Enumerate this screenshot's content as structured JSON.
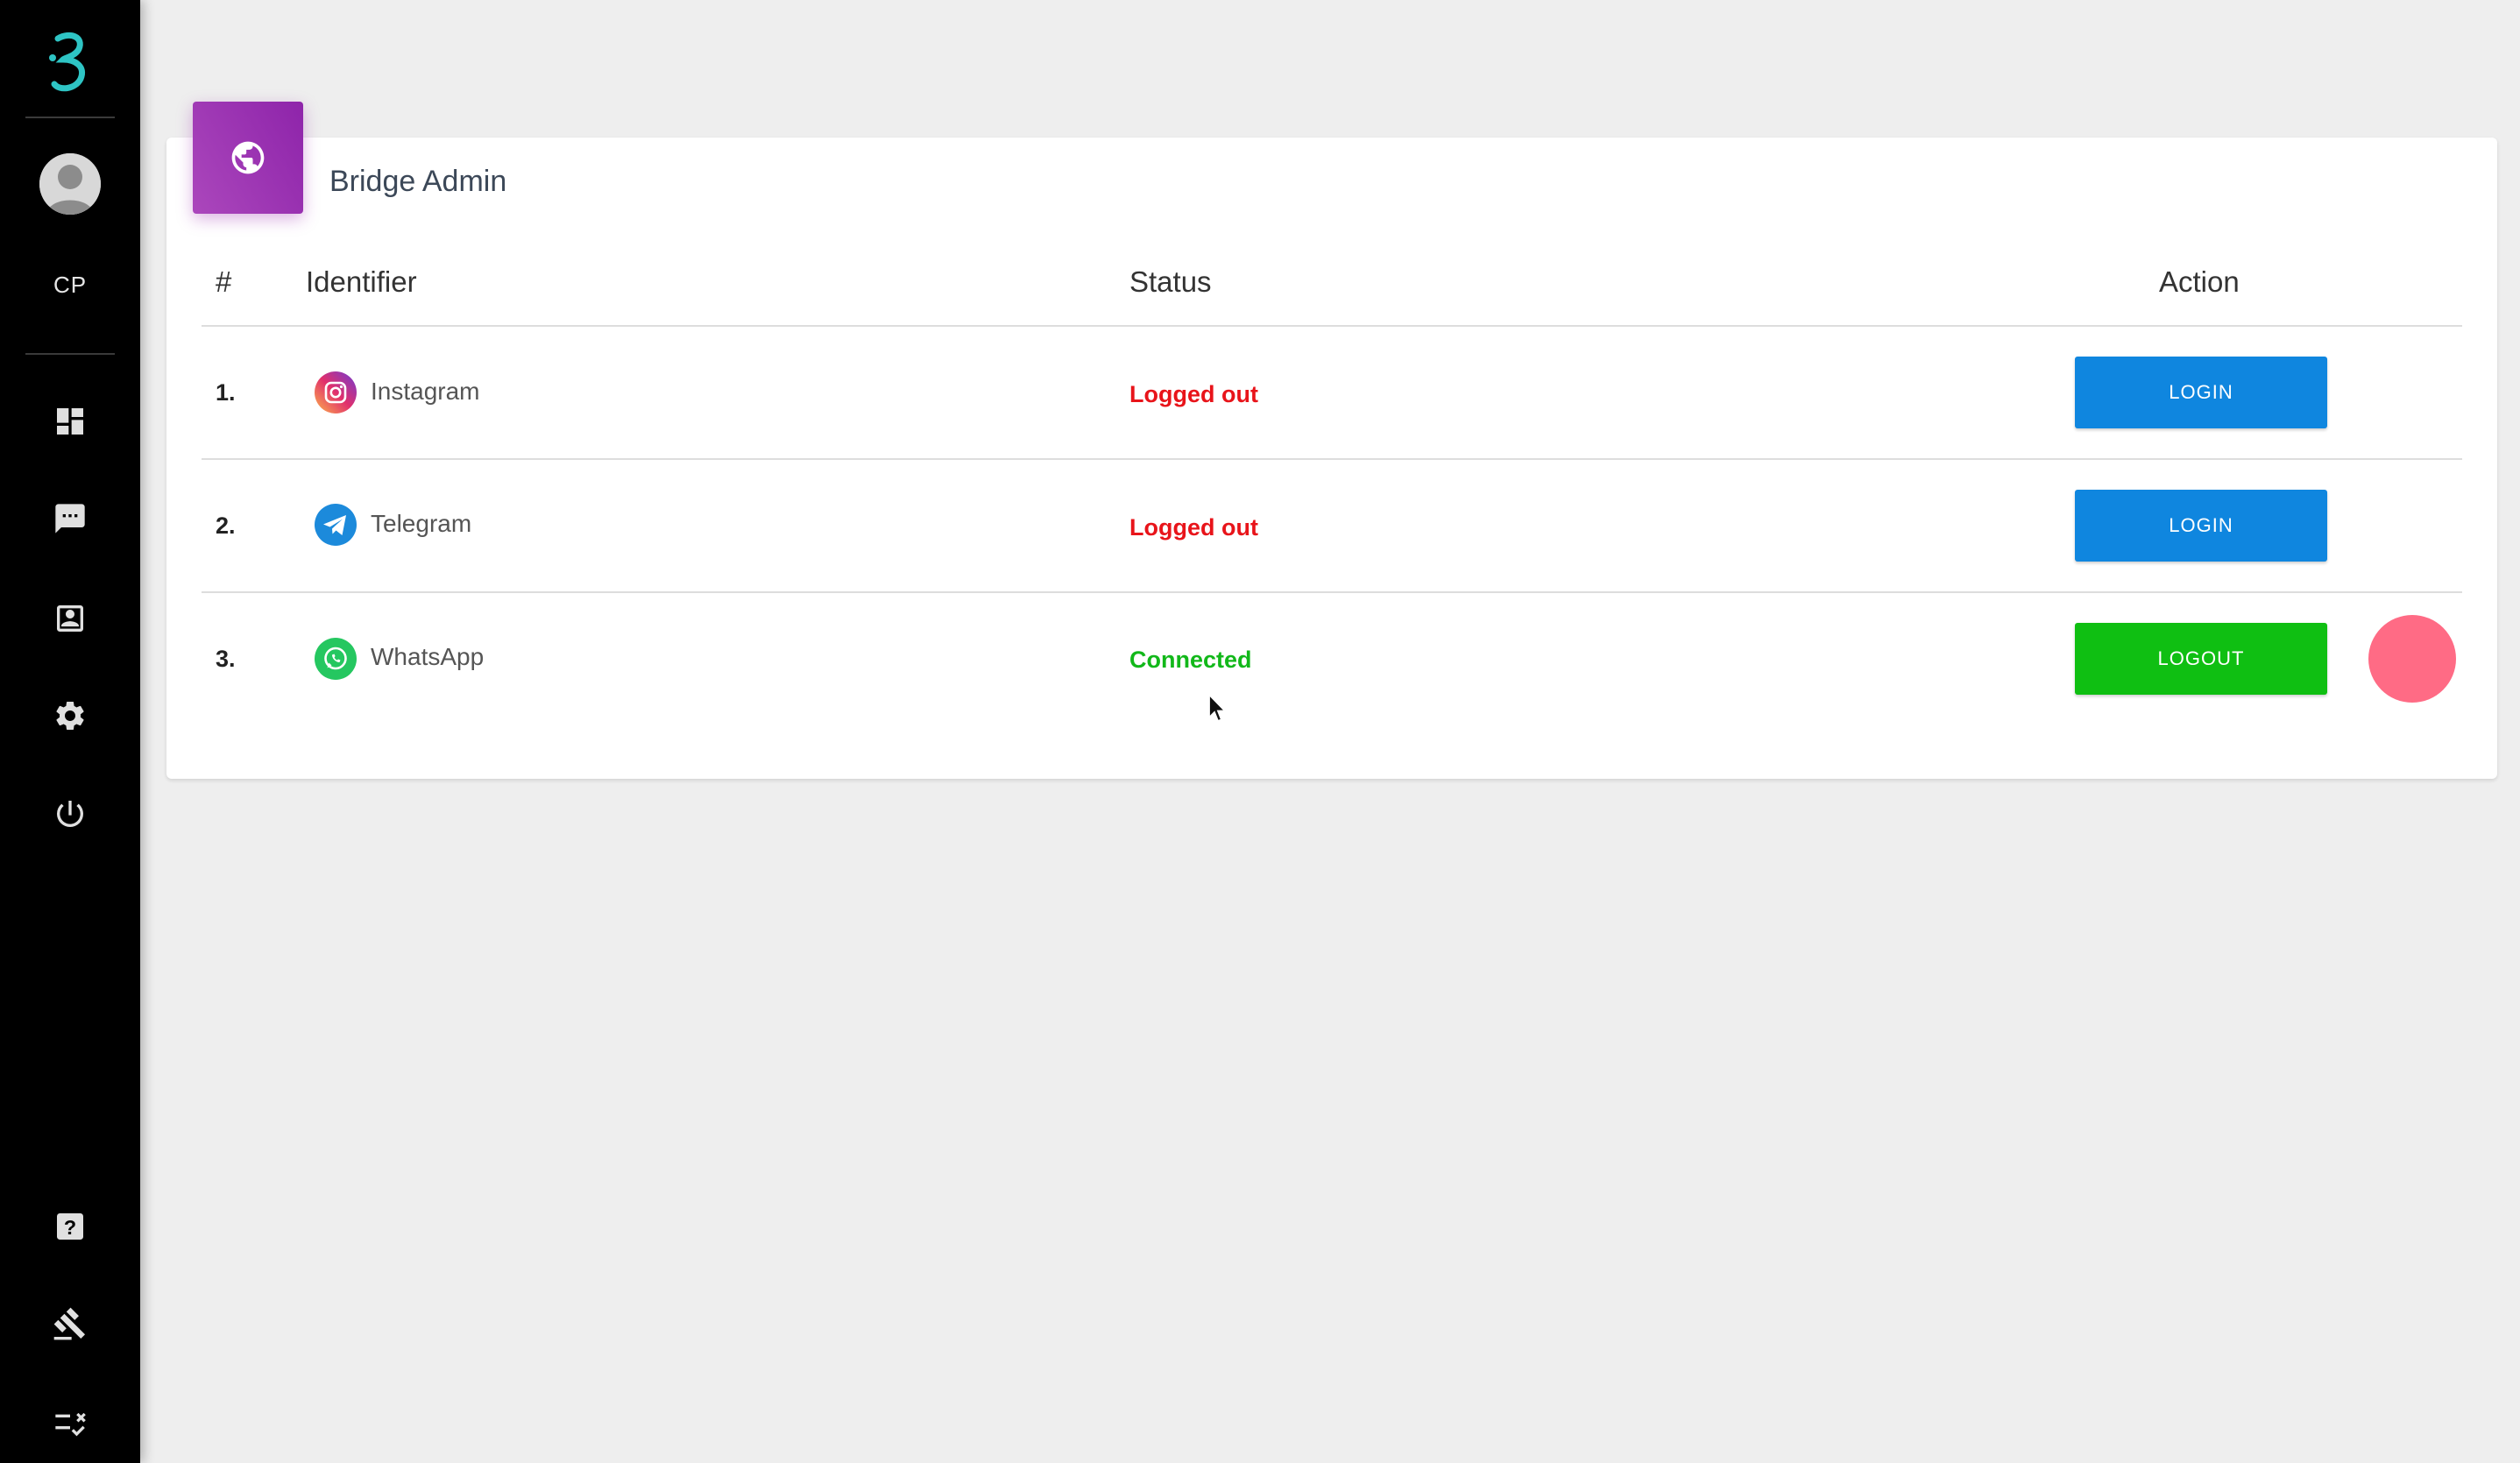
{
  "sidebar": {
    "logo_icon": "brand-b-logo-icon",
    "user_initials": "CP",
    "nav_icons": [
      "dashboard-icon",
      "chat-icon",
      "contacts-icon",
      "settings-icon",
      "power-icon"
    ],
    "bottom_icons": [
      "help-icon",
      "gavel-icon",
      "checklist-icon"
    ],
    "accent_color": "#2ec4c4"
  },
  "card": {
    "badge_icon": "globe-icon",
    "title": "Bridge Admin",
    "badge_color": "#9c27b0"
  },
  "table": {
    "headers": {
      "number": "#",
      "identifier": "Identifier",
      "status": "Status",
      "action": "Action"
    },
    "rows": [
      {
        "number": "1.",
        "icon": "instagram-icon",
        "name": "Instagram",
        "status": "Logged out",
        "action": "LOGIN"
      },
      {
        "number": "2.",
        "icon": "telegram-icon",
        "name": "Telegram",
        "status": "Logged out",
        "action": "LOGIN"
      },
      {
        "number": "3.",
        "icon": "whatsapp-icon",
        "name": "WhatsApp",
        "status": "Connected",
        "action": "LOGOUT"
      }
    ]
  },
  "colors": {
    "logged_out": "#e8141a",
    "connected": "#12b81a",
    "login_button": "#0f86df",
    "logout_button": "#0fbf12",
    "indicator": "#ff6b85"
  }
}
